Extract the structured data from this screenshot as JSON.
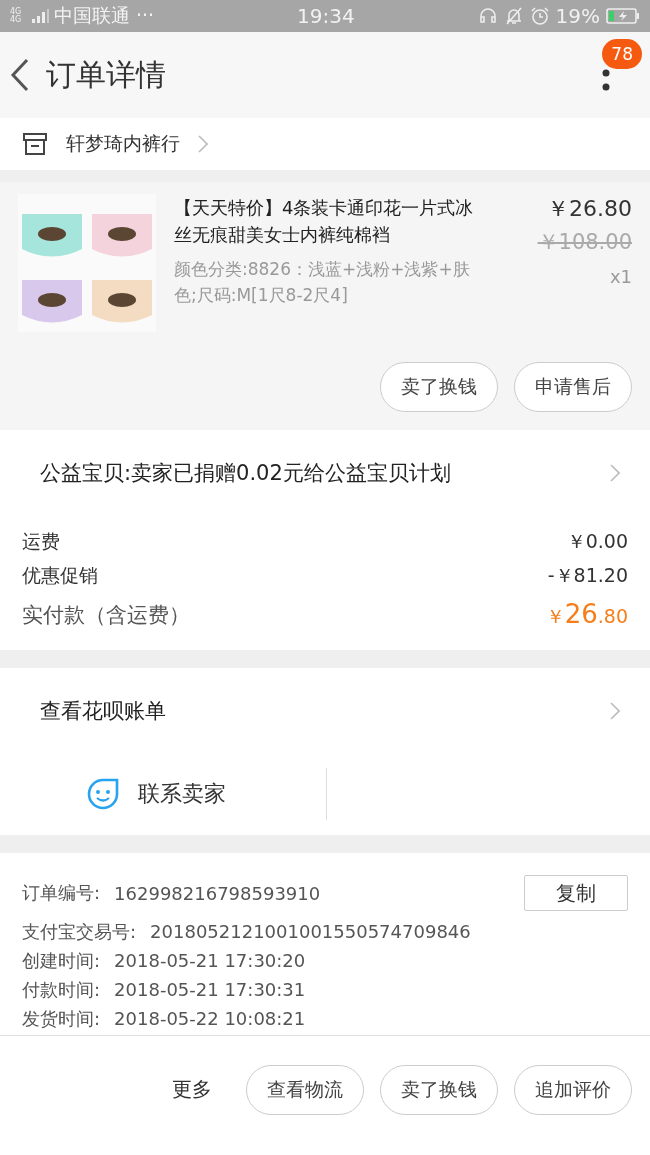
{
  "status_bar": {
    "network": "4G 4G",
    "carrier": "中国联通 ···",
    "time": "19:34",
    "battery": "19%"
  },
  "header": {
    "title": "订单详情",
    "badge": "78"
  },
  "shop": {
    "name": "轩梦琦内裤行"
  },
  "product": {
    "title": "【天天特价】4条装卡通印花一片式冰丝无痕甜美女士内裤纯棉裆",
    "spec": "颜色分类:8826：浅蓝+浅粉+浅紫+肤色;尺码:M[1尺8-2尺4]",
    "price": "￥26.80",
    "original_price": "￥108.00",
    "quantity": "x1",
    "buttons": [
      "卖了换钱",
      "申请售后"
    ]
  },
  "charity": {
    "text": "公益宝贝:卖家已捐赠0.02元给公益宝贝计划"
  },
  "fees": [
    {
      "label": "运费",
      "value": "￥0.00"
    },
    {
      "label": "优惠促销",
      "value": "-￥81.20"
    }
  ],
  "total": {
    "label": "实付款（含运费）",
    "currency": "￥",
    "amount": "26",
    "cents": ".80"
  },
  "huabei": {
    "text": "查看花呗账单"
  },
  "contact": {
    "text": "联系卖家"
  },
  "order_info": [
    {
      "label": "订单编号:",
      "value": "162998216798593910"
    },
    {
      "label": "支付宝交易号:",
      "value": "2018052121001001550574709846"
    },
    {
      "label": "创建时间:",
      "value": "2018-05-21 17:30:20"
    },
    {
      "label": "付款时间:",
      "value": "2018-05-21 17:30:31"
    },
    {
      "label": "发货时间:",
      "value": "2018-05-22 10:08:21"
    }
  ],
  "copy_button": "复制",
  "bottom_bar": {
    "more": "更多",
    "buttons": [
      "查看物流",
      "卖了换钱",
      "追加评价"
    ]
  }
}
